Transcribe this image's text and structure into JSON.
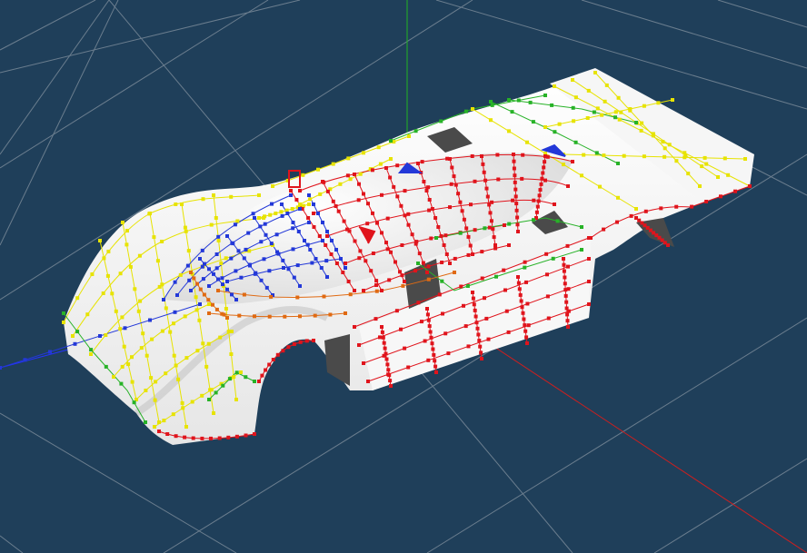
{
  "viewport": {
    "background": "#1f3f5a",
    "grid_color": "#8b98a4",
    "axes": {
      "x_color": "#cc1f1f",
      "y_color": "#21b321",
      "z_color": "#2432ff"
    }
  },
  "model": {
    "body_fill": "#f3f3f3",
    "body_shadow": "#c9c9c9",
    "opening_fill": "#4a4a4a",
    "wire_colors": {
      "yellow": "#e7e300",
      "red": "#e0141c",
      "blue": "#2338d8",
      "green": "#27b227",
      "orange": "#e06a12"
    }
  }
}
